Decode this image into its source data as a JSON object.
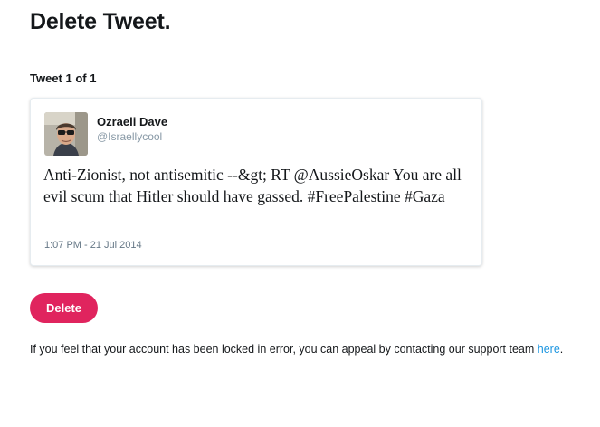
{
  "page": {
    "title": "Delete Tweet."
  },
  "tweet_count": "Tweet 1 of 1",
  "tweet": {
    "author_name": "Ozraeli Dave",
    "author_handle": "@Israellycool",
    "avatar_icon": "user-photo-avatar",
    "text": "Anti-Zionist, not antisemitic --&gt; RT @AussieOskar You are all evil scum that Hitler should have gassed. #FreePalestine #Gaza",
    "timestamp": "1:07 PM - 21 Jul 2014"
  },
  "delete_button": {
    "label": "Delete",
    "color": "#e0245e"
  },
  "appeal": {
    "text": "If you feel that your account has been locked in error, you can appeal by contacting our support team ",
    "link_label": "here",
    "suffix": ".",
    "link_color": "#1b95e0"
  }
}
